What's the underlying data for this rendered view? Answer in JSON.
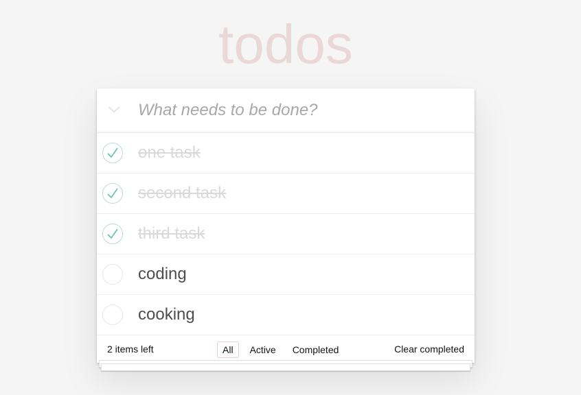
{
  "app": {
    "title": "todos"
  },
  "input": {
    "placeholder": "What needs to be done?",
    "value": ""
  },
  "todos": [
    {
      "label": "one task",
      "completed": true
    },
    {
      "label": "second task",
      "completed": true
    },
    {
      "label": "third task",
      "completed": true
    },
    {
      "label": "coding",
      "completed": false
    },
    {
      "label": "cooking",
      "completed": false
    }
  ],
  "footer": {
    "count_text": "2 items left",
    "filters": [
      "All",
      "Active",
      "Completed"
    ],
    "selected_filter": "All",
    "clear_label": "Clear completed"
  },
  "colors": {
    "title": "#efd5d5",
    "check": "#5dc2af",
    "selected_border": "#e8cfcf"
  },
  "icons": {
    "toggle_all": "chevron-down-icon",
    "completed_check": "checkmark-icon"
  }
}
